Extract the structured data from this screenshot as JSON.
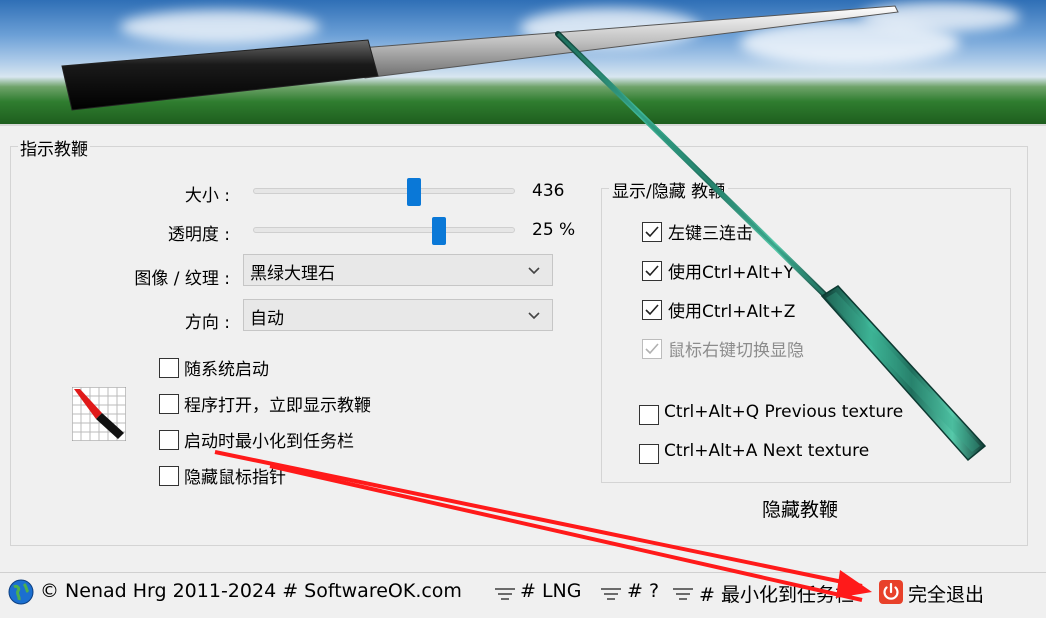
{
  "group": {
    "title": "指示教鞭"
  },
  "size": {
    "label": "大小 :",
    "value": "436",
    "level": 0.62
  },
  "opacity": {
    "label": "透明度 :",
    "value": "25 %",
    "level": 0.72
  },
  "texture": {
    "label": "图像 / 纹理 :",
    "selected": "黑绿大理石"
  },
  "direction": {
    "label": "方向 :",
    "selected": "自动"
  },
  "options": [
    {
      "label": "随系统启动",
      "checked": false
    },
    {
      "label": "程序打开，立即显示教鞭",
      "checked": false
    },
    {
      "label": "启动时最小化到任务栏",
      "checked": false
    },
    {
      "label": "隐藏鼠标指针",
      "checked": false
    }
  ],
  "show_hide": {
    "title": "显示/隐藏 教鞭",
    "items": [
      {
        "label": "左键三连击",
        "checked": true,
        "disabled": false
      },
      {
        "label": "使用Ctrl+Alt+Y",
        "checked": true,
        "disabled": false
      },
      {
        "label": "使用Ctrl+Alt+Z",
        "checked": true,
        "disabled": false
      },
      {
        "label": "鼠标右键切换显隐",
        "checked": true,
        "disabled": true
      }
    ],
    "hotkeys": [
      {
        "label": "Ctrl+Alt+Q Previous texture",
        "checked": false
      },
      {
        "label": "Ctrl+Alt+A Next texture",
        "checked": false
      }
    ]
  },
  "hide_button": "隐藏教鞭",
  "statusbar": {
    "copyright": "© Nenad Hrg 2011-2024 # SoftwareOK.com",
    "lng": "# LNG",
    "help": "# ?",
    "minimize": "# 最小化到任务栏",
    "exit": "完全退出"
  },
  "colors": {
    "accent": "#0a78d7",
    "exit_icon": "#e8412a",
    "arrow": "#ff1a1a"
  }
}
